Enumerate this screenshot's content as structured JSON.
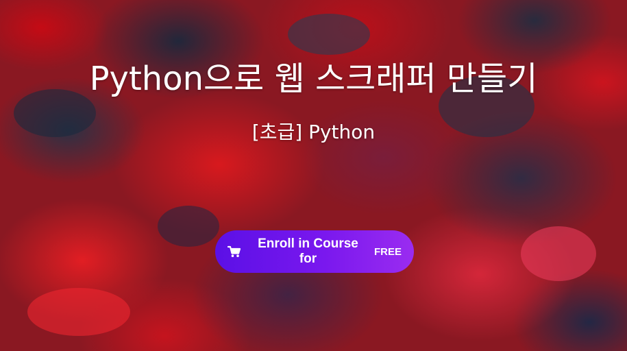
{
  "hero": {
    "title": "Python으로 웹 스크래퍼 만들기",
    "subtitle": "[초급] Python"
  },
  "enroll": {
    "label": "Enroll in Course for",
    "price": "FREE",
    "icon": "shopping-cart-icon"
  },
  "colors": {
    "button_start": "#5b10e6",
    "button_end": "#9a2cf0",
    "text": "#ffffff",
    "background_red": "#d81e28",
    "background_dark": "#1e2c40"
  }
}
